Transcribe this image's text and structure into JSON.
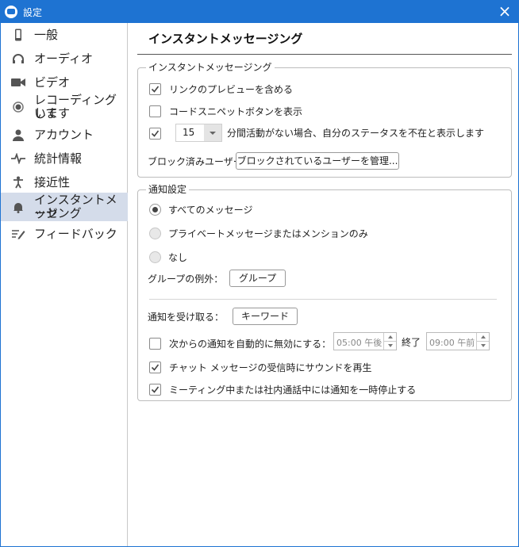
{
  "window": {
    "title": "設定",
    "close_glyph": "×"
  },
  "sidebar": {
    "items": [
      {
        "label": "一般",
        "icon": "phone-icon"
      },
      {
        "label": "オーディオ",
        "icon": "headphones-icon"
      },
      {
        "label": "ビデオ",
        "icon": "video-camera-icon"
      },
      {
        "label": "レコーディングしています",
        "line1": "レコーディングして",
        "line2": "います",
        "icon": "record-icon"
      },
      {
        "label": "アカウント",
        "icon": "person-icon"
      },
      {
        "label": "統計情報",
        "icon": "pulse-icon"
      },
      {
        "label": "接近性",
        "icon": "accessibility-icon"
      },
      {
        "label": "インスタントメッセージング",
        "line1": "インスタントメッセ",
        "line2": "ージング",
        "icon": "bell-icon",
        "active": true
      },
      {
        "label": "フィードバック",
        "icon": "feedback-icon"
      }
    ]
  },
  "main": {
    "title": "インスタントメッセージング",
    "im_group": {
      "legend": "インスタントメッセージング",
      "link_preview": {
        "label": "リンクのプレビューを含める",
        "checked": true
      },
      "code_snippet": {
        "label": "コードスニペットボタンを表示",
        "checked": false
      },
      "away": {
        "checked": true,
        "minutes": "15",
        "label": "分間活動がない場合、自分のステータスを不在と表示します"
      },
      "blocked_label": "ブロック済みユーザー",
      "blocked_button": "ブロックされているユーザーを管理..."
    },
    "notify_group": {
      "legend": "通知設定",
      "options": [
        {
          "label": "すべてのメッセージ",
          "selected": true
        },
        {
          "label": "プライベートメッセージまたはメンションのみ",
          "selected": false
        },
        {
          "label": "なし",
          "selected": false
        }
      ],
      "group_exception_label": "グループの例外：",
      "group_button": "グループ",
      "keyword_label": "通知を受け取る：",
      "keyword_button": "キーワード",
      "auto_disable": {
        "label": "次からの通知を自動的に無効にする：",
        "checked": false,
        "start": "05:00 午後",
        "end_label": "終了",
        "end": "09:00 午前"
      },
      "sound": {
        "label": "チャット メッセージの受信時にサウンドを再生",
        "checked": true
      },
      "pause_meeting": {
        "label": "ミーティング中または社内通話中には通知を一時停止する",
        "checked": true
      }
    }
  },
  "colors": {
    "titlebar": "#1e73d2",
    "active_item": "#d4dcea"
  }
}
